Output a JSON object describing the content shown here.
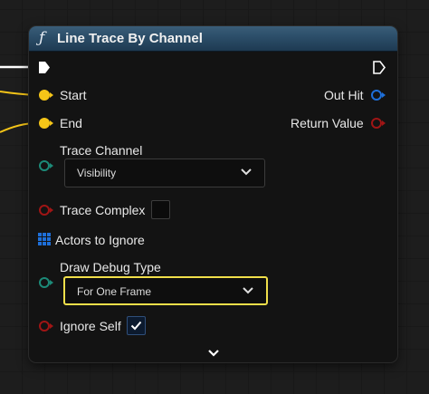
{
  "node": {
    "title": "Line Trace By Channel",
    "title_icon": "function-icon",
    "header_color": "#2b4d68"
  },
  "pins": {
    "exec_in": {
      "type": "exec"
    },
    "exec_out": {
      "type": "exec"
    },
    "start": {
      "label": "Start",
      "color": "#f5c518"
    },
    "end": {
      "label": "End",
      "color": "#f5c518"
    },
    "out_hit": {
      "label": "Out Hit",
      "color": "#1e6fd9"
    },
    "return_value": {
      "label": "Return Value",
      "color": "#a01515"
    },
    "trace_channel": {
      "label": "Trace Channel",
      "color": "#1c8a78",
      "value": "Visibility"
    },
    "trace_complex": {
      "label": "Trace Complex",
      "color": "#a01515",
      "checked": false
    },
    "actors_to_ignore": {
      "label": "Actors to Ignore",
      "color": "#1e6fd9"
    },
    "draw_debug_type": {
      "label": "Draw Debug Type",
      "color": "#1c8a78",
      "value": "For One Frame"
    },
    "ignore_self": {
      "label": "Ignore Self",
      "color": "#a01515",
      "checked": true
    }
  },
  "focus_color": "#f0df4a",
  "expand_icon": "chevron-down-icon"
}
